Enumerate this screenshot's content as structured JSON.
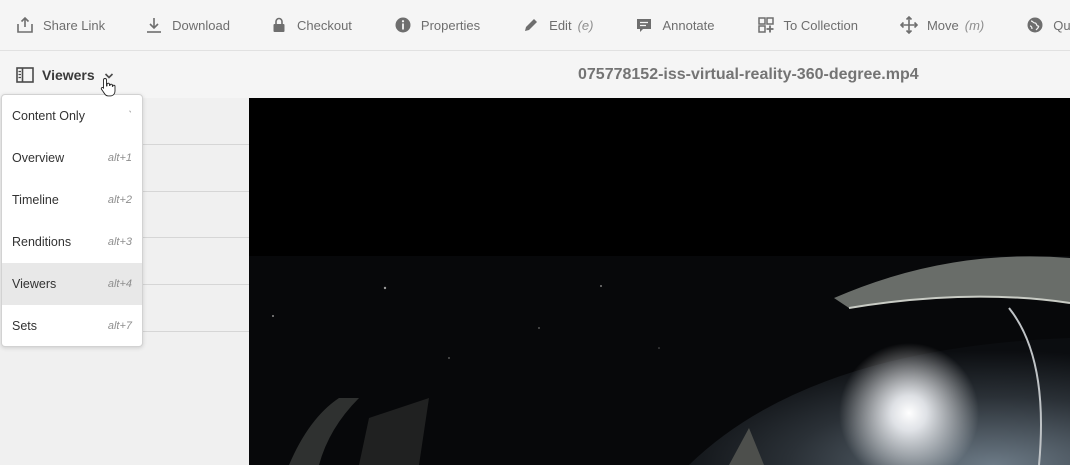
{
  "toolbar": {
    "items": [
      {
        "label": "Share Link",
        "shortcut": "",
        "icon": "share-icon"
      },
      {
        "label": "Download",
        "shortcut": "",
        "icon": "download-icon"
      },
      {
        "label": "Checkout",
        "shortcut": "",
        "icon": "lock-icon"
      },
      {
        "label": "Properties",
        "shortcut": "",
        "icon": "info-icon"
      },
      {
        "label": "Edit",
        "shortcut": "(e)",
        "icon": "pencil-icon"
      },
      {
        "label": "Annotate",
        "shortcut": "",
        "icon": "comment-icon"
      },
      {
        "label": "To Collection",
        "shortcut": "",
        "icon": "collection-add-icon"
      },
      {
        "label": "Move",
        "shortcut": "(m)",
        "icon": "move-icon"
      },
      {
        "label": "Quick Pu",
        "shortcut": "",
        "icon": "globe-icon"
      }
    ]
  },
  "header": {
    "rail_label": "Viewers",
    "rail_icon": "rail-icon",
    "chevron_icon": "chevron-down-icon",
    "title": "075778152-iss-virtual-reality-360-degree.mp4"
  },
  "menu": {
    "items": [
      {
        "label": "Content Only",
        "shortcut": "`",
        "selected": false
      },
      {
        "label": "Overview",
        "shortcut": "alt+1",
        "selected": false
      },
      {
        "label": "Timeline",
        "shortcut": "alt+2",
        "selected": false
      },
      {
        "label": "Renditions",
        "shortcut": "alt+3",
        "selected": false
      },
      {
        "label": "Viewers",
        "shortcut": "alt+4",
        "selected": true
      },
      {
        "label": "Sets",
        "shortcut": "alt+7",
        "selected": false
      }
    ]
  },
  "colors": {
    "background": "#f5f5f5",
    "toolbar_text": "#6e6e6e",
    "viewer_bg": "#000000",
    "selected_item": "#e8e8e8"
  }
}
